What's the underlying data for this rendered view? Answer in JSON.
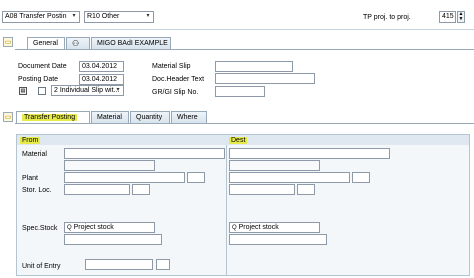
{
  "header": {
    "action_value": "A08 Transfer Postin",
    "reference_value": "R10 Other",
    "tp_label": "TP proj. to proj.",
    "tp_value": "415"
  },
  "header_tabs": [
    {
      "label": "General"
    },
    {
      "label": ""
    },
    {
      "label": "MIGO BAdI EXAMPLE"
    }
  ],
  "general": {
    "document_date_label": "Document Date",
    "document_date_value": "03.04.2012",
    "posting_date_label": "Posting Date",
    "posting_date_value": "03.04.2012",
    "print_option_value": "2 Individual Slip wit...",
    "material_slip_label": "Material Slip",
    "doc_header_text_label": "Doc.Header Text",
    "gr_gi_slip_label": "GR/GI Slip No."
  },
  "item_tabs": [
    {
      "label": "Transfer Posting"
    },
    {
      "label": "Material"
    },
    {
      "label": "Quantity"
    },
    {
      "label": "Where"
    }
  ],
  "transfer": {
    "from_label": "From",
    "dest_label": "Dest",
    "material_label": "Material",
    "plant_label": "Plant",
    "stor_loc_label": "Stor. Loc.",
    "spec_stock_label": "Spec.Stock",
    "from_spec_stock_value": "Project stock",
    "dest_spec_stock_value": "Project stock",
    "unit_of_entry_label": "Unit of Entry"
  },
  "colors": {
    "highlight": "#e6ea4a",
    "tab_border": "#9aa9b8",
    "input_border": "#8e9aa8"
  }
}
